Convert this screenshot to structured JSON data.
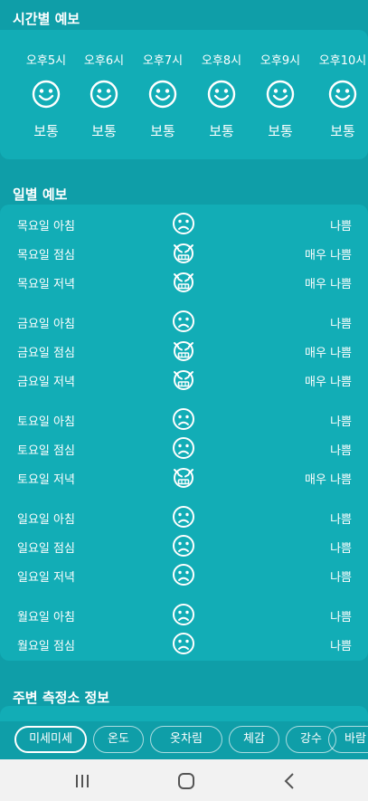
{
  "hourly": {
    "title": "시간별 예보",
    "items": [
      {
        "time": "오후5시",
        "status": "보통"
      },
      {
        "time": "오후6시",
        "status": "보통"
      },
      {
        "time": "오후7시",
        "status": "보통"
      },
      {
        "time": "오후8시",
        "status": "보통"
      },
      {
        "time": "오후9시",
        "status": "보통"
      },
      {
        "time": "오후10시",
        "status": "보통"
      }
    ]
  },
  "daily": {
    "title": "일별 예보",
    "rows": [
      {
        "label": "목요일 아침",
        "icon": "sad-face-icon",
        "status": "나쁨"
      },
      {
        "label": "목요일 점심",
        "icon": "devil-face-icon",
        "status": "매우 나쁨"
      },
      {
        "label": "목요일 저녁",
        "icon": "devil-face-icon",
        "status": "매우 나쁨"
      },
      {
        "label": "금요일 아침",
        "icon": "sad-face-icon",
        "status": "나쁨"
      },
      {
        "label": "금요일 점심",
        "icon": "devil-face-icon",
        "status": "매우 나쁨"
      },
      {
        "label": "금요일 저녁",
        "icon": "devil-face-icon",
        "status": "매우 나쁨"
      },
      {
        "label": "토요일 아침",
        "icon": "sad-face-icon",
        "status": "나쁨"
      },
      {
        "label": "토요일 점심",
        "icon": "sad-face-icon",
        "status": "나쁨"
      },
      {
        "label": "토요일 저녁",
        "icon": "devil-face-icon",
        "status": "매우 나쁨"
      },
      {
        "label": "일요일 아침",
        "icon": "sad-face-icon",
        "status": "나쁨"
      },
      {
        "label": "일요일 점심",
        "icon": "sad-face-icon",
        "status": "나쁨"
      },
      {
        "label": "일요일 저녁",
        "icon": "sad-face-icon",
        "status": "나쁨"
      },
      {
        "label": "월요일 아침",
        "icon": "sad-face-icon",
        "status": "나쁨"
      },
      {
        "label": "월요일 점심",
        "icon": "sad-face-icon",
        "status": "나쁨"
      }
    ]
  },
  "nearby": {
    "title": "주변 측정소 정보"
  },
  "tabs": [
    {
      "label": "미세미세",
      "active": true
    },
    {
      "label": "온도",
      "active": false
    },
    {
      "label": "옷차림",
      "active": false
    },
    {
      "label": "체감",
      "active": false
    },
    {
      "label": "강수",
      "active": false
    },
    {
      "label": "바람",
      "active": false
    }
  ],
  "colors": {
    "background": "#0f9ea8",
    "card": "#12adb6",
    "text": "#ffffff",
    "nav": "#f2f2f2"
  }
}
